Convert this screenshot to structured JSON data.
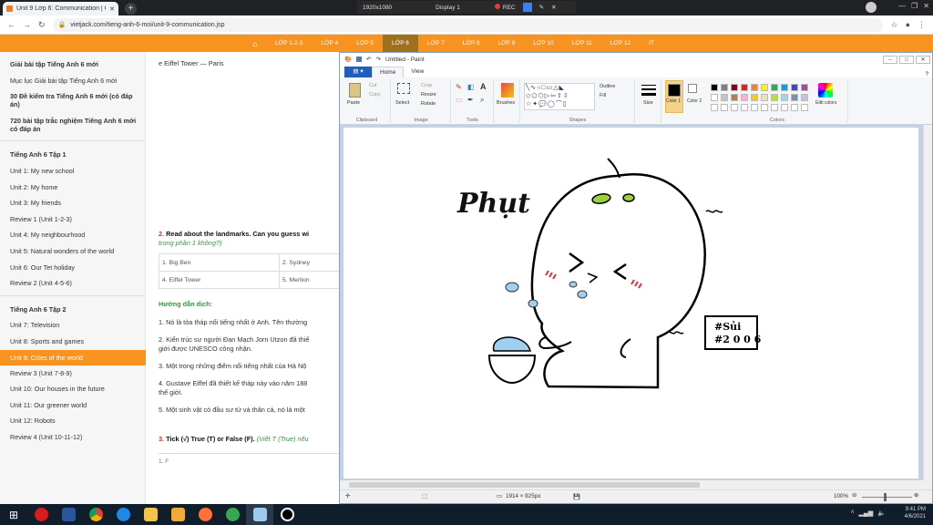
{
  "browser": {
    "tab_title": "Unit 9 Lớp 6: Communication | G",
    "new_tab": "+",
    "url": "vietjack.com/tieng-anh-6-moi/unit-9-communication.jsp",
    "recorder": {
      "resolution": "1920x1080",
      "display": "Display 1",
      "rec": "REC"
    }
  },
  "site_nav": {
    "items": [
      "LỚP 1-2-3",
      "LỚP 4",
      "LỚP 5",
      "LỚP 6",
      "LỚP 7",
      "LỚP 8",
      "LỚP 9",
      "LỚP 10",
      "LỚP 11",
      "LỚP 12",
      "IT"
    ],
    "active": "LỚP 6",
    "accent": "#f7931e"
  },
  "sidebar": {
    "top_links": [
      "Giải bài tập Tiếng Anh 6 mới",
      "Mục lục Giải bài tập Tiếng Anh 6 mới",
      "30 Đề kiểm tra Tiếng Anh 6 mới (có đáp án)",
      "720 bài tập trắc nghiệm Tiếng Anh 6 mới có đáp án"
    ],
    "book1_title": "Tiếng Anh 6 Tập 1",
    "book1": [
      "Unit 1: My new school",
      "Unit 2: My home",
      "Unit 3: My friends",
      "Review 1 (Unit 1-2-3)",
      "Unit 4: My neighbourhood",
      "Unit 5: Natural wonders of the world",
      "Unit 6: Our Tet holiday",
      "Review 2 (Unit 4-5-6)"
    ],
    "book2_title": "Tiếng Anh 6 Tập 2",
    "book2": [
      "Unit 7: Television",
      "Unit 8: Sports and games",
      "Unit 9: Cities of the world",
      "Review 3 (Unit 7-8-9)",
      "Unit 10: Our houses in the future",
      "Unit 11: Our greener world",
      "Unit 12: Robots",
      "Review 4 (Unit 10-11-12)"
    ],
    "active_item": "Unit 9: Cities of the world"
  },
  "article": {
    "top_line": "e Eiffel Tower — Paris",
    "q2_num": "2.",
    "q2_text": "Read about the landmarks. Can you guess wi",
    "q2_sub": "trong phần 1 không?)",
    "table": [
      [
        "1. Big Ben",
        "2. Sydney"
      ],
      [
        "4. Eiffel Tower",
        "5. Merlion"
      ]
    ],
    "guide_title": "Hướng dẫn dịch:",
    "guide": [
      "1. Nó là tòa tháp nổi tiếng nhất ở Anh. Tên thường",
      "2. Kiến trúc sư người Đan Mạch Jorn Utzon đã thiế",
      "giới được UNESCO công nhận.",
      "3. Một trong những điểm nổi tiếng nhất của Hà Nộ",
      "4. Gustave Eiffel đã thiết kế tháp này vào năm 188",
      "thế giới.",
      "5. Một sinh vật có đầu sư tử và thân cá, nó là một"
    ],
    "q3_num": "3.",
    "q3_text": "Tick (√) True (T) or False (F).",
    "q3_sub": "(Viết T (True) nếu",
    "q3_item": "1. F"
  },
  "paint": {
    "title": "Untitled - Paint",
    "tabs": [
      "Home",
      "View"
    ],
    "groups": [
      "Clipboard",
      "Image",
      "Tools",
      "Shapes",
      "Colors"
    ],
    "clipboard": {
      "paste": "Paste",
      "cut": "Cut",
      "copy": "Copy"
    },
    "image": {
      "select": "Select",
      "crop": "Crop",
      "resize": "Resize",
      "rotate": "Rotate"
    },
    "brushes": "Brushes",
    "outline": "Outline",
    "fill": "Fill",
    "size": "Size",
    "color1": "Color 1",
    "color2": "Color 2",
    "edit_colors": "Edit colors",
    "palette": [
      "#000000",
      "#7f7f7f",
      "#880015",
      "#ed1c24",
      "#ff7f27",
      "#fff200",
      "#22b14c",
      "#00a2e8",
      "#3f48cc",
      "#a349a4",
      "#ffffff",
      "#c3c3c3",
      "#b97a57",
      "#ffaec9",
      "#ffc90e",
      "#efe4b0",
      "#b5e61d",
      "#99d9ea",
      "#7092be",
      "#c8bfe7"
    ],
    "status_size": "1914 × 925px",
    "zoom": "100%",
    "drawing": {
      "phut": "Phụt",
      "tag_line1": "#Sủi",
      "tag_line2": "#2 0 0 6"
    }
  },
  "taskbar": {
    "time": "9:41 PM",
    "date": "4/6/2021",
    "apps": [
      "opera",
      "word",
      "chrome",
      "edge",
      "explorer",
      "media",
      "firefox",
      "green-app",
      "paint",
      "recorder"
    ]
  }
}
